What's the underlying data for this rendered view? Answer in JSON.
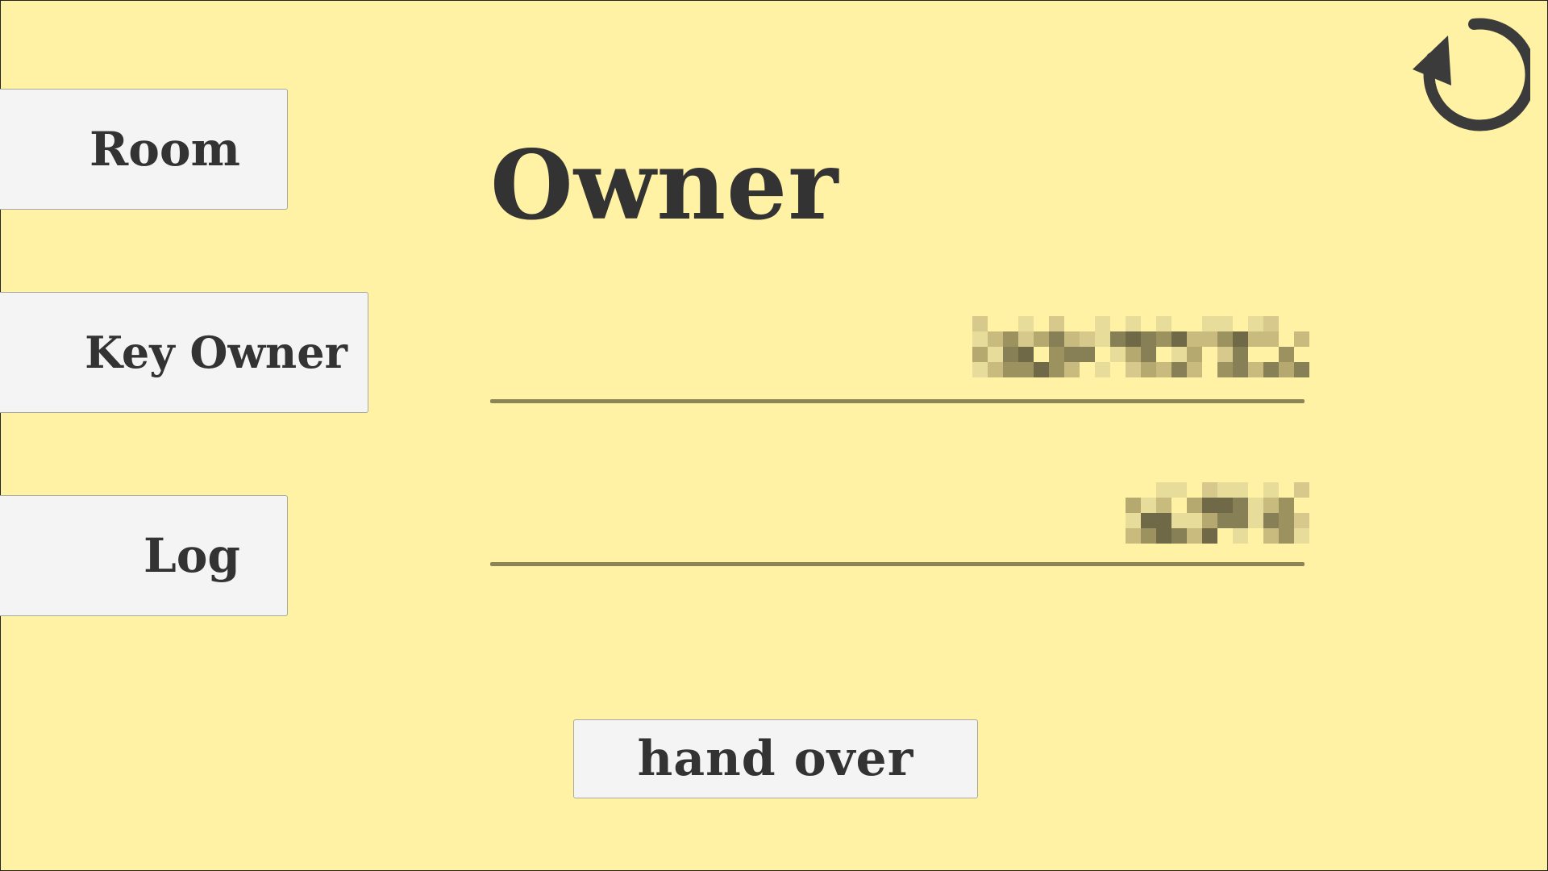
{
  "nav": {
    "room_label": "Room",
    "key_owner_label": "Key Owner",
    "log_label": "Log"
  },
  "main": {
    "title": "Owner",
    "hand_over_label": "hand over"
  },
  "icons": {
    "refresh": "refresh-icon"
  },
  "colors": {
    "background": "#fff2a5",
    "button_bg": "#f4f4f4",
    "text": "#333333",
    "underline": "#8a8456"
  }
}
